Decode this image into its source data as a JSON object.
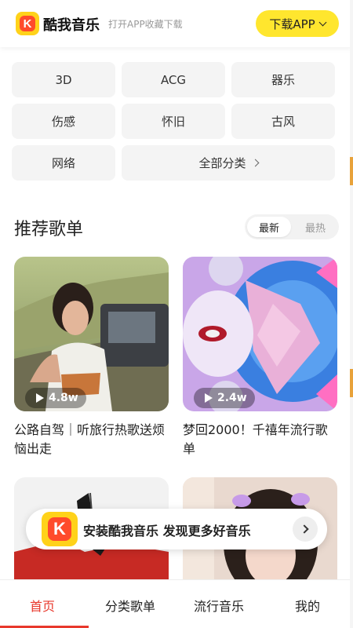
{
  "header": {
    "app_name": "酷我音乐",
    "slogan": "打开APP收藏下载",
    "download_label": "下载APP",
    "logo_letter": "K"
  },
  "categories": [
    {
      "label": "3D"
    },
    {
      "label": "ACG"
    },
    {
      "label": "器乐"
    },
    {
      "label": "伤感"
    },
    {
      "label": "怀旧"
    },
    {
      "label": "古风"
    },
    {
      "label": "网络"
    },
    {
      "label": "全部分类"
    }
  ],
  "section": {
    "title": "推荐歌单",
    "tabs": [
      {
        "label": "最新",
        "active": true
      },
      {
        "label": "最热",
        "active": false
      }
    ]
  },
  "playlists": [
    {
      "plays": "4.8w",
      "title": "公路自驾｜听旅行热歌送烦恼出走"
    },
    {
      "plays": "2.4w",
      "title": "梦回2000！千禧年流行歌单"
    },
    {
      "plays": "",
      "title": ""
    },
    {
      "plays": "",
      "title": ""
    }
  ],
  "install_banner": {
    "text": "安装酷我音乐 发现更多好音乐"
  },
  "tabbar": {
    "items": [
      {
        "label": "首页",
        "active": true
      },
      {
        "label": "分类歌单",
        "active": false
      },
      {
        "label": "流行音乐",
        "active": false
      },
      {
        "label": "我的",
        "active": false
      }
    ]
  },
  "colors": {
    "accent": "#e8382c",
    "brand_yellow": "#ffe62e"
  }
}
